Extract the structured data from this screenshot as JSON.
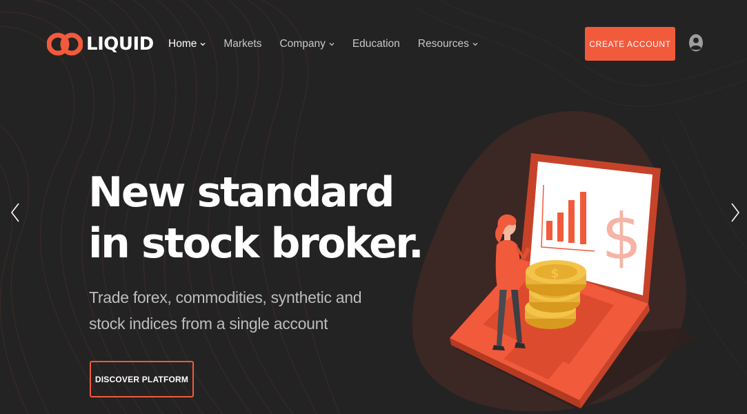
{
  "brand": {
    "name": "LIQUID",
    "accent_color": "#f25a3c",
    "background_color": "#232323"
  },
  "nav": {
    "items": [
      {
        "label": "Home",
        "has_dropdown": true,
        "active": true
      },
      {
        "label": "Markets",
        "has_dropdown": false,
        "active": false
      },
      {
        "label": "Company",
        "has_dropdown": true,
        "active": false
      },
      {
        "label": "Education",
        "has_dropdown": false,
        "active": false
      },
      {
        "label": "Resources",
        "has_dropdown": true,
        "active": false
      }
    ]
  },
  "header": {
    "cta_label": "CREATE ACCOUNT",
    "account_icon": "user-circle-icon"
  },
  "hero": {
    "headline_line1": "New standard",
    "headline_line2": "in stock broker.",
    "subtitle": "Trade forex, commodities, synthetic and stock indices from a single account",
    "button_label": "DISCOVER PLATFORM"
  },
  "slider": {
    "prev_icon": "chevron-left-icon",
    "next_icon": "chevron-right-icon"
  },
  "illustration": {
    "currency_symbol": "$",
    "coin_symbol": "$"
  }
}
